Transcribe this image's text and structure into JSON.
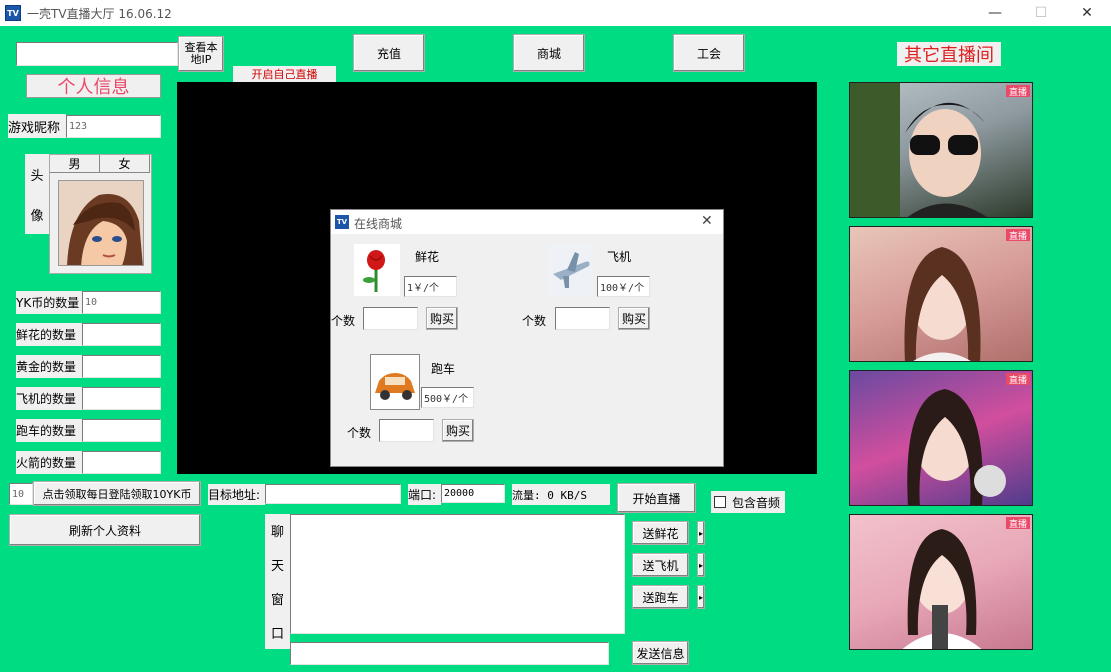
{
  "window": {
    "title": "一壳TV直播大厅   16.06.12",
    "app_icon": "TV"
  },
  "top": {
    "view_ip_button": "查看本\n地IP",
    "start_own_live": "开启自己直播",
    "recharge_button": "充值",
    "shop_button": "商城",
    "guild_button": "工会",
    "other_rooms_title": "其它直播间"
  },
  "profile": {
    "section_title": "个人信息",
    "nickname_label": "游戏昵称",
    "nickname_value": "123",
    "avatar_label_1": "头",
    "avatar_label_2": "像",
    "tab_male": "男",
    "tab_female": "女",
    "counts": [
      {
        "label": "YK币的数量",
        "value": "10"
      },
      {
        "label": "鲜花的数量",
        "value": ""
      },
      {
        "label": "黄金的数量",
        "value": ""
      },
      {
        "label": "飞机的数量",
        "value": ""
      },
      {
        "label": "跑车的数量",
        "value": ""
      },
      {
        "label": "火箭的数量",
        "value": ""
      }
    ],
    "daily_value": "10",
    "daily_button": "点击领取每日登陆领取10YK币",
    "refresh_button": "刷新个人资料"
  },
  "stream": {
    "target_label": "目标地址:",
    "target_value": "",
    "port_label": "端口:",
    "port_value": "20000",
    "flow_label": "流量: 0 KB/S",
    "start_button": "开始直播",
    "audio_checkbox": "包含音频"
  },
  "chat": {
    "label_chars": [
      "聊",
      "天",
      "窗",
      "口"
    ],
    "send_flower": "送鲜花",
    "send_plane": "送飞机",
    "send_car": "送跑车",
    "send_message": "发送信息"
  },
  "shop_dialog": {
    "title": "在线商城",
    "items": [
      {
        "name": "鲜花",
        "price": "1￥/个",
        "qty_label": "个数",
        "buy": "购买",
        "icon": "rose-icon"
      },
      {
        "name": "飞机",
        "price": "100￥/个",
        "qty_label": "个数",
        "buy": "购买",
        "icon": "airplane-icon"
      },
      {
        "name": "跑车",
        "price": "500￥/个",
        "qty_label": "个数",
        "buy": "购买",
        "icon": "car-icon"
      }
    ]
  },
  "live_rooms": [
    {
      "badge": "直播"
    },
    {
      "badge": "直播"
    },
    {
      "badge": "直播"
    },
    {
      "badge": "直播"
    }
  ],
  "colors": {
    "background": "#00dc82",
    "title_red": "#e02020",
    "profile_title": "#e94a6a",
    "live_badge": "#e94a6a"
  }
}
